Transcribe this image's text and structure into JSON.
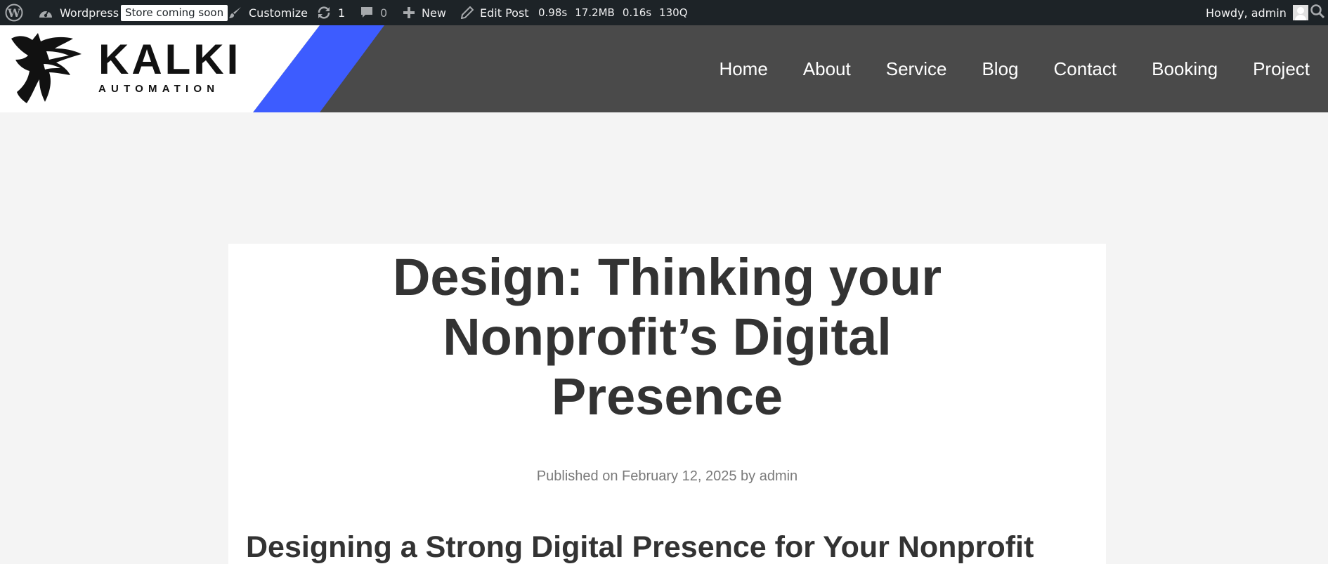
{
  "adminbar": {
    "site_name": "Wordpress",
    "store_badge": "Store coming soon",
    "customize": "Customize",
    "updates_count": "1",
    "comments_count": "0",
    "new": "New",
    "edit_post": "Edit Post",
    "stats": {
      "time": "0.98s",
      "memory": "17.2MB",
      "db_time": "0.16s",
      "queries": "130Q"
    },
    "greeting": "Howdy, admin",
    "icons": [
      "wordpress-icon",
      "dashboard-icon",
      "paintbrush-icon",
      "refresh-icon",
      "comment-icon",
      "plus-icon",
      "pencil-icon",
      "avatar",
      "search-icon"
    ]
  },
  "header": {
    "brand": "KALKI",
    "tagline": "AUTOMATION",
    "accent_color": "#3d5cff",
    "nav": [
      {
        "label": "Home"
      },
      {
        "label": "About"
      },
      {
        "label": "Service"
      },
      {
        "label": "Blog"
      },
      {
        "label": "Contact"
      },
      {
        "label": "Booking"
      },
      {
        "label": "Project"
      }
    ]
  },
  "post": {
    "title_lines": [
      "Design: Thinking your",
      "Nonprofit’s Digital",
      "Presence"
    ],
    "meta": {
      "prefix": "Published on",
      "date": "February 12, 2025",
      "by": "by",
      "author": "admin"
    },
    "section_heading": "Designing a Strong Digital Presence for Your Nonprofit"
  }
}
